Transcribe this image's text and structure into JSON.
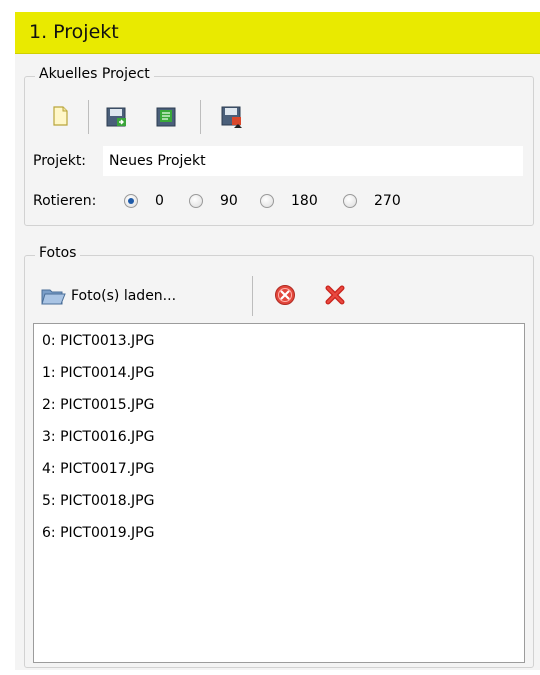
{
  "header": {
    "title": "1. Projekt",
    "accent": "#e9ea00"
  },
  "project": {
    "legend": "Akuelles Project",
    "toolbar": {
      "new_icon": "new-document-icon",
      "save_icon": "save-icon",
      "save_as_icon": "save-as-icon",
      "export_icon": "export-icon"
    },
    "name_label": "Projekt:",
    "name_value": "Neues Projekt",
    "rotate_label": "Rotieren:",
    "rotate_options": [
      "0",
      "90",
      "180",
      "270"
    ],
    "rotate_selected": "0"
  },
  "photos": {
    "legend": "Fotos",
    "load_button": "Foto(s) laden...",
    "files": [
      "0: PICT0013.JPG",
      "1: PICT0014.JPG",
      "2: PICT0015.JPG",
      "3: PICT0016.JPG",
      "4: PICT0017.JPG",
      "5: PICT0018.JPG",
      "6: PICT0019.JPG"
    ]
  }
}
